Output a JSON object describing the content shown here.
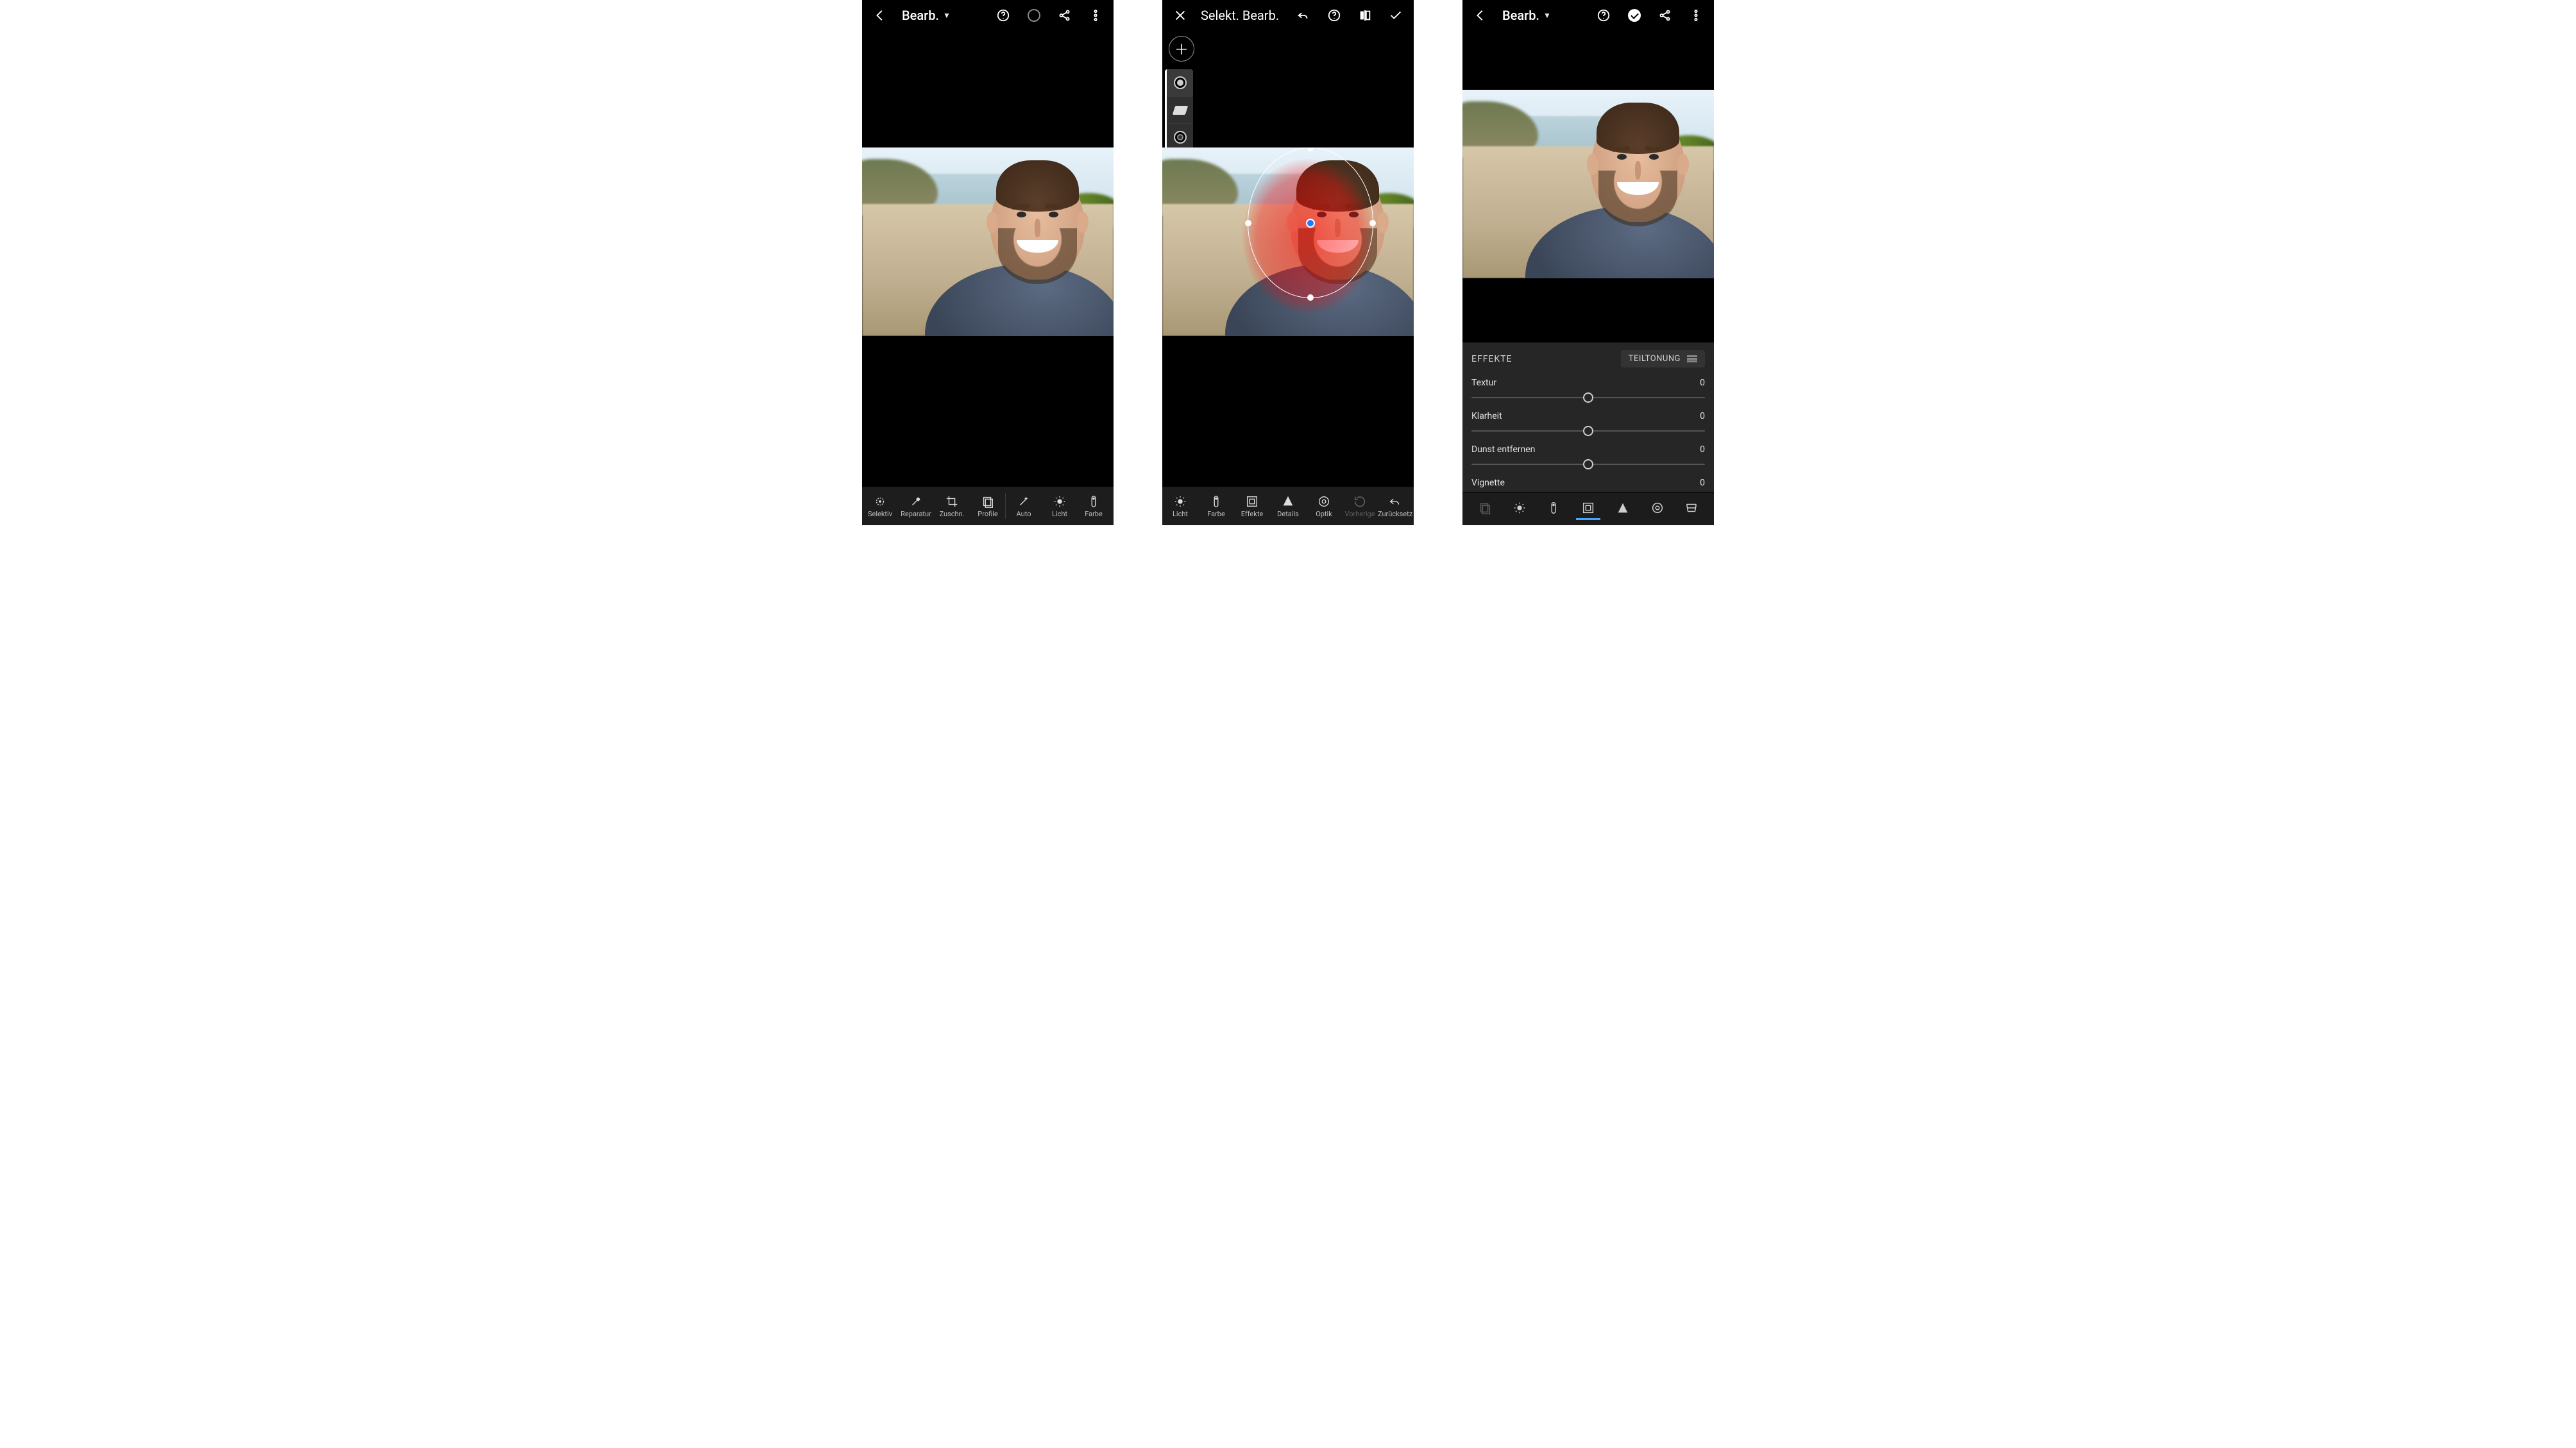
{
  "panes": {
    "p1": {
      "title": "Bearb.",
      "toolbar": [
        {
          "key": "selektiv",
          "label": "Selektiv"
        },
        {
          "key": "reparatur",
          "label": "Reparatur"
        },
        {
          "key": "zuschn",
          "label": "Zuschn."
        },
        {
          "key": "profile",
          "label": "Profile"
        },
        {
          "key": "auto",
          "label": "Auto"
        },
        {
          "key": "licht",
          "label": "Licht"
        },
        {
          "key": "farbe",
          "label": "Farbe"
        }
      ]
    },
    "p2": {
      "title": "Selekt. Bearb.",
      "tools": [
        "brush",
        "eraser",
        "radial",
        "invert",
        "delete"
      ],
      "toolbar": [
        {
          "key": "licht",
          "label": "Licht"
        },
        {
          "key": "farbe",
          "label": "Farbe"
        },
        {
          "key": "effekte",
          "label": "Effekte"
        },
        {
          "key": "details",
          "label": "Details"
        },
        {
          "key": "optik",
          "label": "Optik"
        },
        {
          "key": "vorherige",
          "label": "Vorherige",
          "disabled": true
        },
        {
          "key": "zuruecksetz",
          "label": "Zurücksetz"
        }
      ]
    },
    "p3": {
      "title": "Bearb.",
      "panel": {
        "heading": "EFFEKTE",
        "split_label": "TEILTONUNG",
        "sliders": [
          {
            "name": "Textur",
            "value": 0,
            "pos": 50
          },
          {
            "name": "Klarheit",
            "value": 0,
            "pos": 50
          },
          {
            "name": "Dunst entfernen",
            "value": 0,
            "pos": 50
          },
          {
            "name": "Vignette",
            "value": 0,
            "pos": 50
          }
        ],
        "icons": [
          "profile",
          "light",
          "color",
          "effects",
          "detail",
          "optics",
          "geometry"
        ],
        "active_icon": "effects"
      }
    }
  }
}
